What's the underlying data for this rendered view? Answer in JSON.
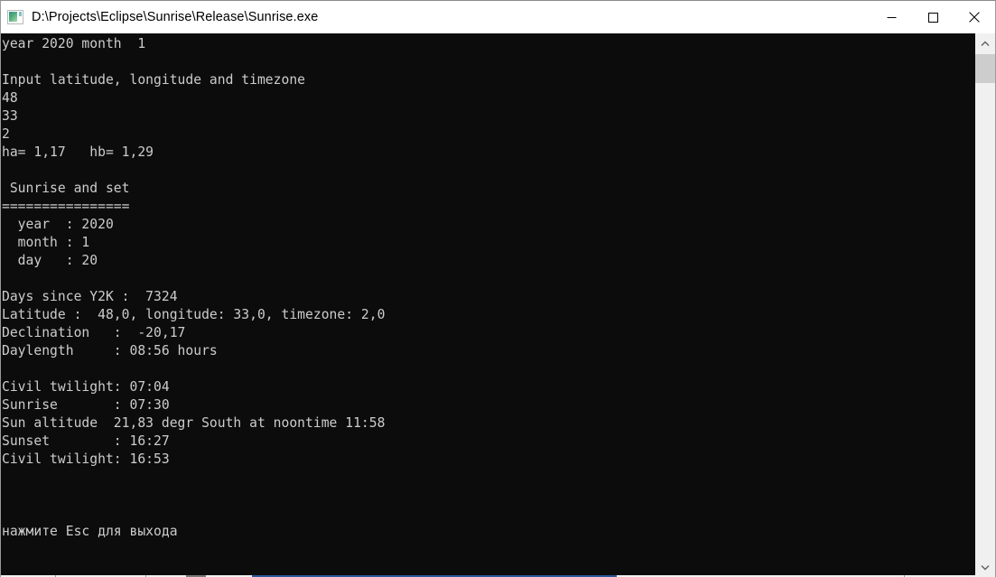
{
  "window": {
    "title": "D:\\Projects\\Eclipse\\Sunrise\\Release\\Sunrise.exe",
    "icon": "console-app-icon",
    "controls": {
      "minimize_label": "Minimize",
      "maximize_label": "Maximize",
      "close_label": "Close"
    },
    "background_color": "#0c0c0c",
    "text_color": "#cccccc",
    "titlebar_color": "#ffffff"
  },
  "console": {
    "lines": [
      "year 2020 month  1",
      "",
      "Input latitude, longitude and timezone",
      "48",
      "33",
      "2",
      "ha= 1,17   hb= 1,29",
      "",
      " Sunrise and set",
      "================",
      "  year  : 2020",
      "  month : 1",
      "  day   : 20",
      "",
      "Days since Y2K :  7324",
      "Latitude :  48,0, longitude: 33,0, timezone: 2,0",
      "Declination   :  -20,17",
      "Daylength     : 08:56 hours",
      "",
      "Civil twilight: 07:04",
      "Sunrise       : 07:30",
      "Sun altitude  21,83 degr South at noontime 11:58",
      "Sunset        : 16:27",
      "Civil twilight: 16:53",
      "",
      "",
      "",
      "нажмите Esc для выхода"
    ],
    "fields": {
      "year": "2020",
      "month": "1",
      "day": "20",
      "input_prompt": "Input latitude, longitude and timezone",
      "latitude_input": "48",
      "longitude_input": "33",
      "timezone_input": "2",
      "ha": "1,17",
      "hb": "1,29",
      "section_title": "Sunrise and set",
      "separator": "================",
      "days_since_y2k": "7324",
      "latitude": "48,0",
      "longitude": "33,0",
      "timezone": "2,0",
      "declination": "-20,17",
      "daylength": "08:56 hours",
      "civil_twilight_morning": "07:04",
      "sunrise": "07:30",
      "sun_altitude": "21,83 degr South at noontime 11:58",
      "sunset": "16:27",
      "civil_twilight_evening": "16:53",
      "exit_prompt": "нажмите Esc для выхода"
    }
  },
  "scrollbars": {
    "vertical": {
      "up_arrow": "chevron-up-icon",
      "down_arrow": "chevron-down-icon",
      "thumb_position_percent": 4
    }
  }
}
